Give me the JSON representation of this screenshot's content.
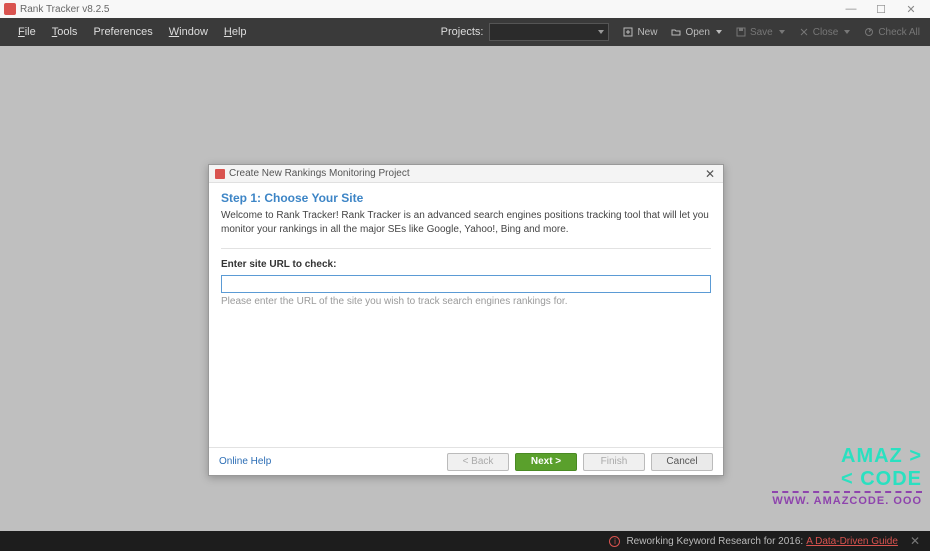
{
  "title_bar": {
    "title": "Rank Tracker v8.2.5"
  },
  "menu": {
    "file": "File",
    "tools": "Tools",
    "preferences": "Preferences",
    "window": "Window",
    "help": "Help",
    "projects_label": "Projects:",
    "new": "New",
    "open": "Open",
    "save": "Save",
    "close": "Close",
    "check_all": "Check All"
  },
  "dialog": {
    "title": "Create New Rankings Monitoring Project",
    "step_title": "Step 1: Choose Your Site",
    "description": "Welcome to Rank Tracker! Rank Tracker is an advanced search engines positions tracking tool that will let you monitor your rankings in all the major SEs like Google, Yahoo!, Bing and more.",
    "url_label": "Enter site URL to check:",
    "url_value": "",
    "url_hint": "Please enter the URL of the site you wish to track search engines rankings for.",
    "help_link": "Online Help",
    "back": "< Back",
    "next": "Next >",
    "finish": "Finish",
    "cancel": "Cancel"
  },
  "status": {
    "msg": "Reworking Keyword Research for 2016:",
    "link": "A Data-Driven Guide"
  },
  "watermark": {
    "l1": "AMAZ >",
    "l2": "< CODE",
    "l3": "WWW. AMAZCODE. OOO"
  }
}
